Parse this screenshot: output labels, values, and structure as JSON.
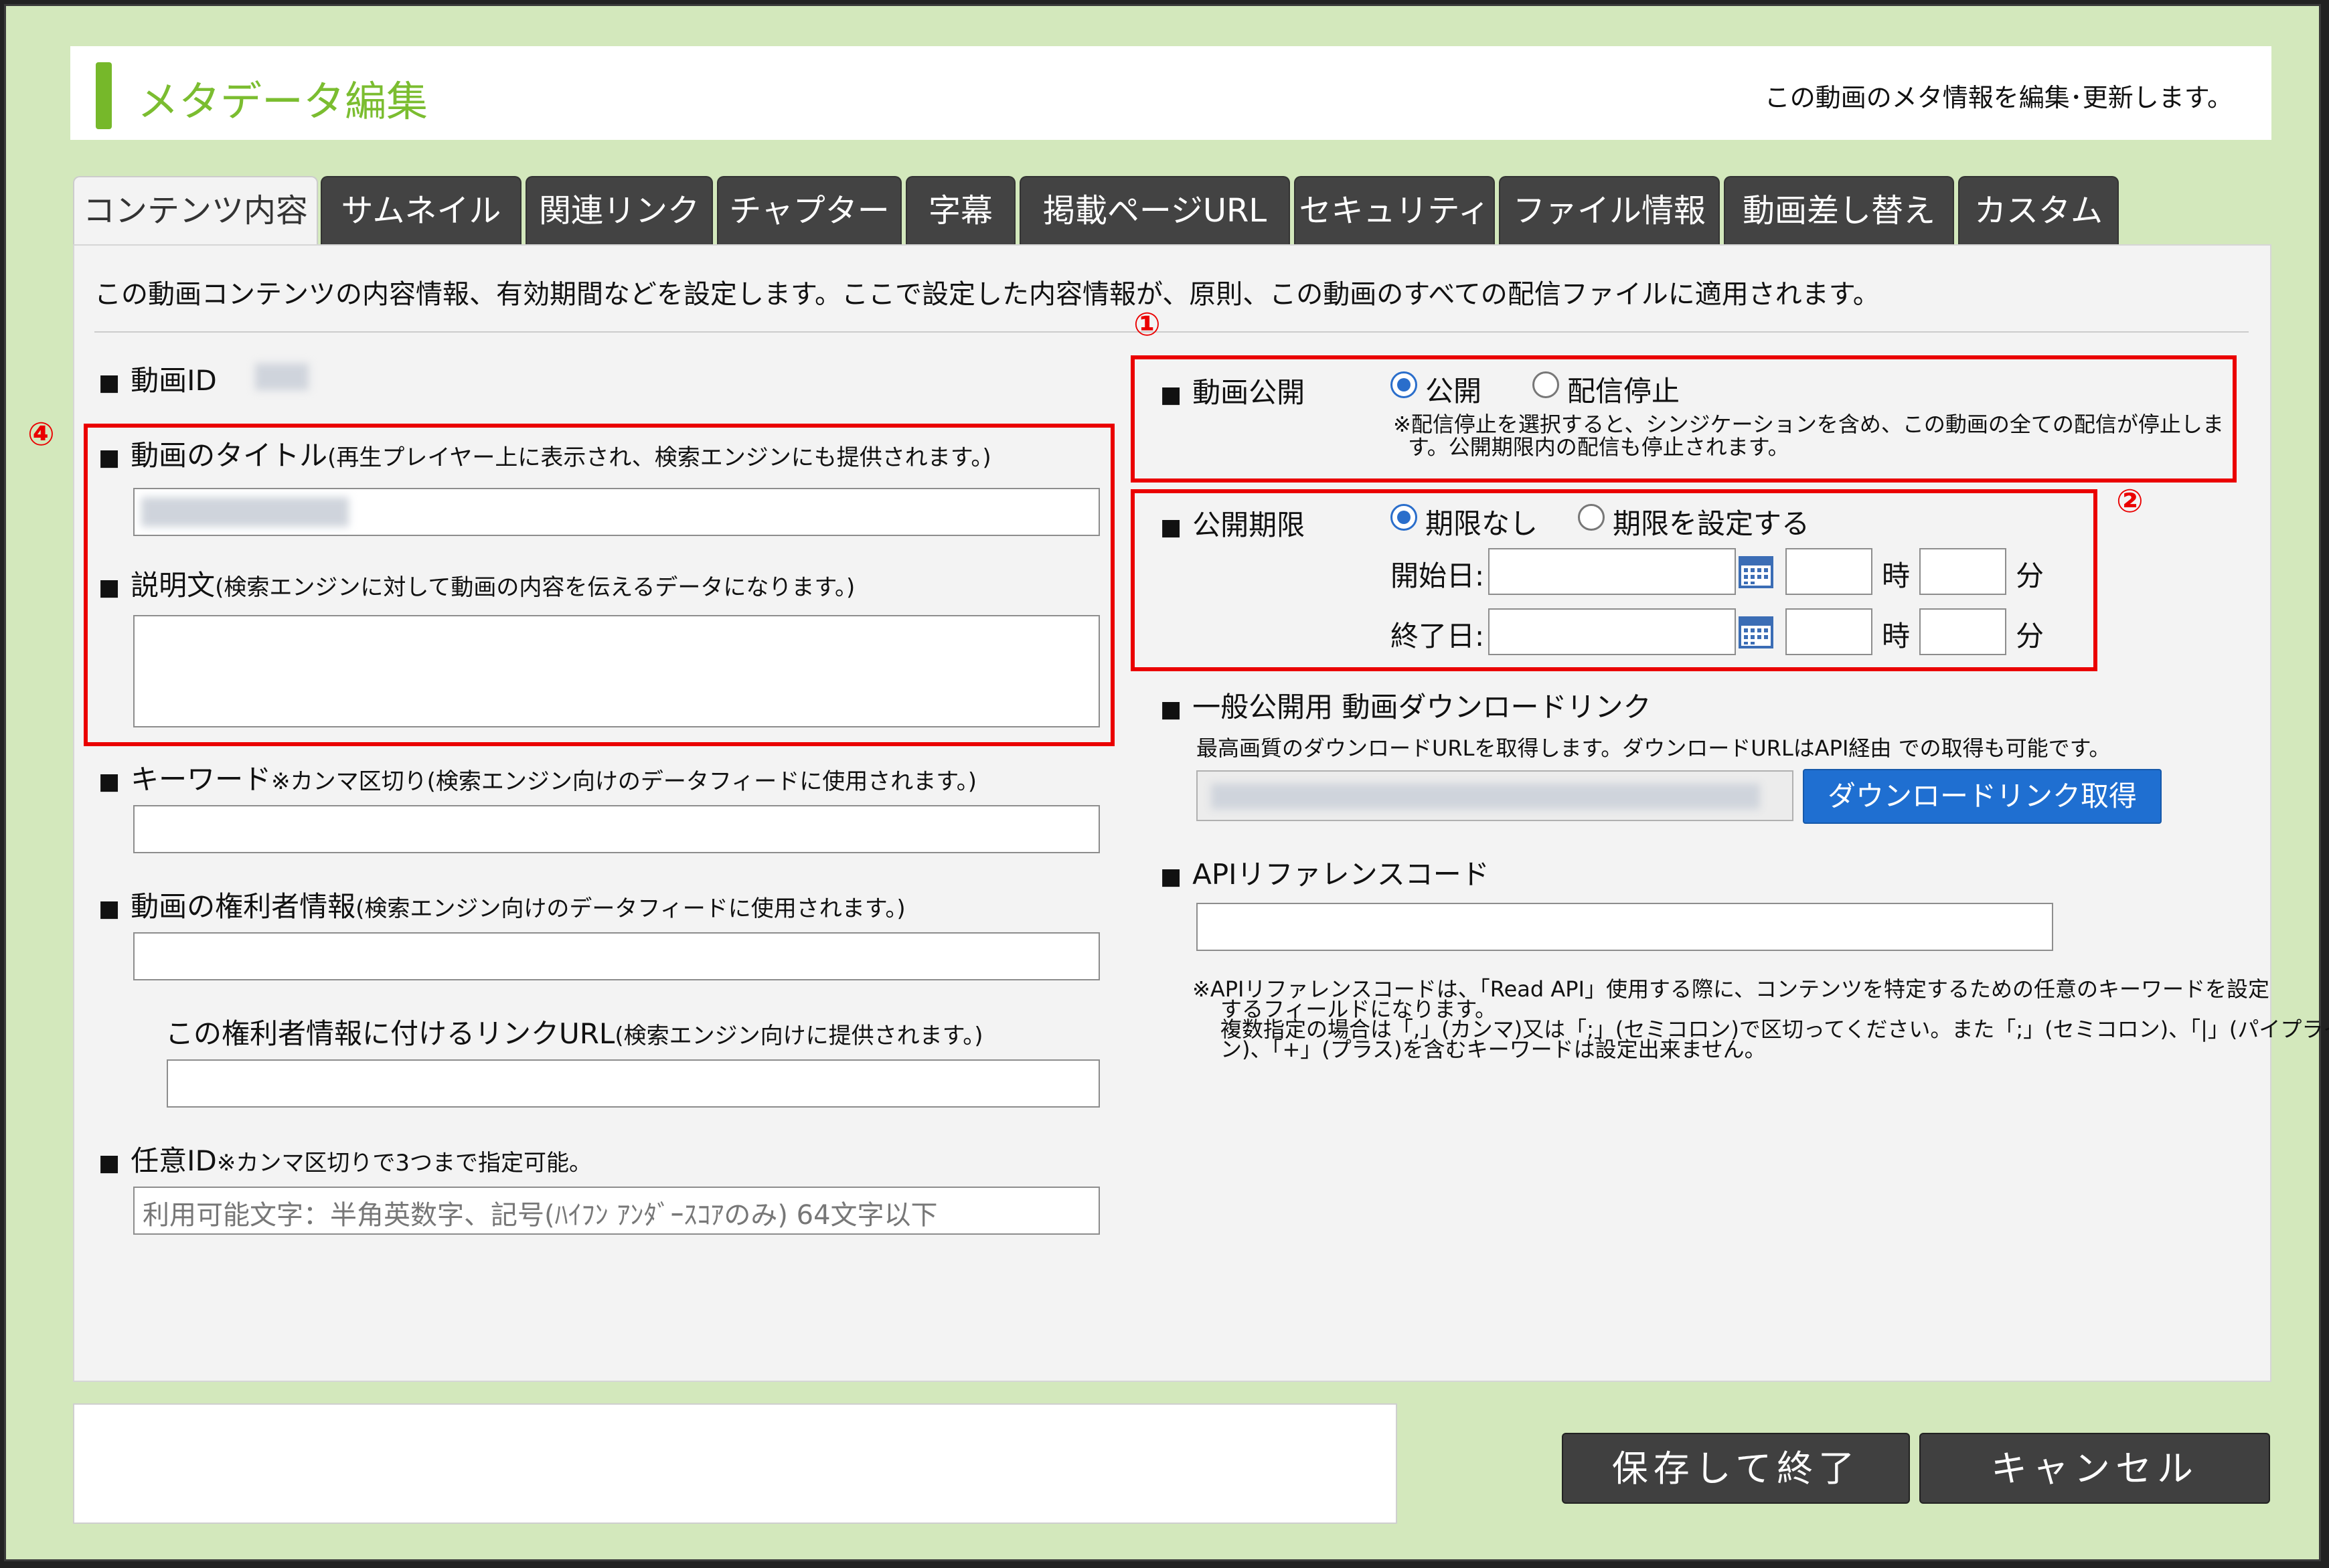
{
  "header": {
    "title": "メタデータ編集",
    "description": "この動画のメタ情報を編集･更新します。"
  },
  "tabs": [
    "コンテンツ内容",
    "サムネイル",
    "関連リンク",
    "チャプター",
    "字幕",
    "掲載ページURL",
    "セキュリティ",
    "ファイル情報",
    "動画差し替え",
    "カスタム"
  ],
  "intro": "この動画コンテンツの内容情報、有効期間などを設定します。ここで設定した内容情報が、原則、この動画のすべての配信ファイルに適用されます。",
  "markers": {
    "m1": "①",
    "m2": "②",
    "m4": "④"
  },
  "square": "■",
  "left": {
    "video_id": {
      "label": "動画ID"
    },
    "title": {
      "label": "動画のタイトル",
      "note": "(再生プレイヤー上に表示され、検索エンジンにも提供されます。)"
    },
    "description": {
      "label": "説明文",
      "note": "(検索エンジンに対して動画の内容を伝えるデータになります。)"
    },
    "keywords": {
      "label": "キーワード",
      "note": "※カンマ区切り(検索エンジン向けのデータフィードに使用されます。)"
    },
    "rights": {
      "label": "動画の権利者情報",
      "note": "(検索エンジン向けのデータフィードに使用されます。)"
    },
    "rights_url": {
      "label": "この権利者情報に付けるリンクURL",
      "note": "(検索エンジン向けに提供されます。)"
    },
    "custom_id": {
      "label": "任意ID",
      "note": "※カンマ区切りで3つまで指定可能。",
      "placeholder": "利用可能文字：半角英数字、記号(ﾊｲﾌﾝ ｱﾝﾀﾞｰｽｺｱのみ) 64文字以下"
    }
  },
  "right": {
    "publish": {
      "label": "動画公開",
      "option_on": "公開",
      "option_off": "配信停止",
      "note_line1": "※配信停止を選択すると、シンジケーションを含め、この動画の全ての配信が停止しま",
      "note_line2": "す。公開期限内の配信も停止されます。"
    },
    "period": {
      "label": "公開期限",
      "option_none": "期限なし",
      "option_set": "期限を設定する",
      "start": "開始日:",
      "end": "終了日:",
      "hour": "時",
      "minute": "分"
    },
    "download": {
      "label": "一般公開用 動画ダウンロードリンク",
      "note": "最高画質のダウンロードURLを取得します。ダウンロードURLはAPI経由 での取得も可能です。",
      "button": "ダウンロードリンク取得"
    },
    "api": {
      "label": "APIリファレンスコード",
      "note_line1": "※APIリファレンスコードは、「Read API」使用する際に、コンテンツを特定するための任意のキーワードを設定",
      "note_line2": "するフィールドになります。",
      "note_line3": "複数指定の場合は「,」(カンマ)又は「;」(セミコロン)で区切ってください。また「;」(セミコロン)、「|」(パイプライ",
      "note_line4": "ン)、「+」(プラス)を含むキーワードは設定出来ません。"
    }
  },
  "footer": {
    "save": "保存して終了",
    "cancel": "キャンセル"
  }
}
